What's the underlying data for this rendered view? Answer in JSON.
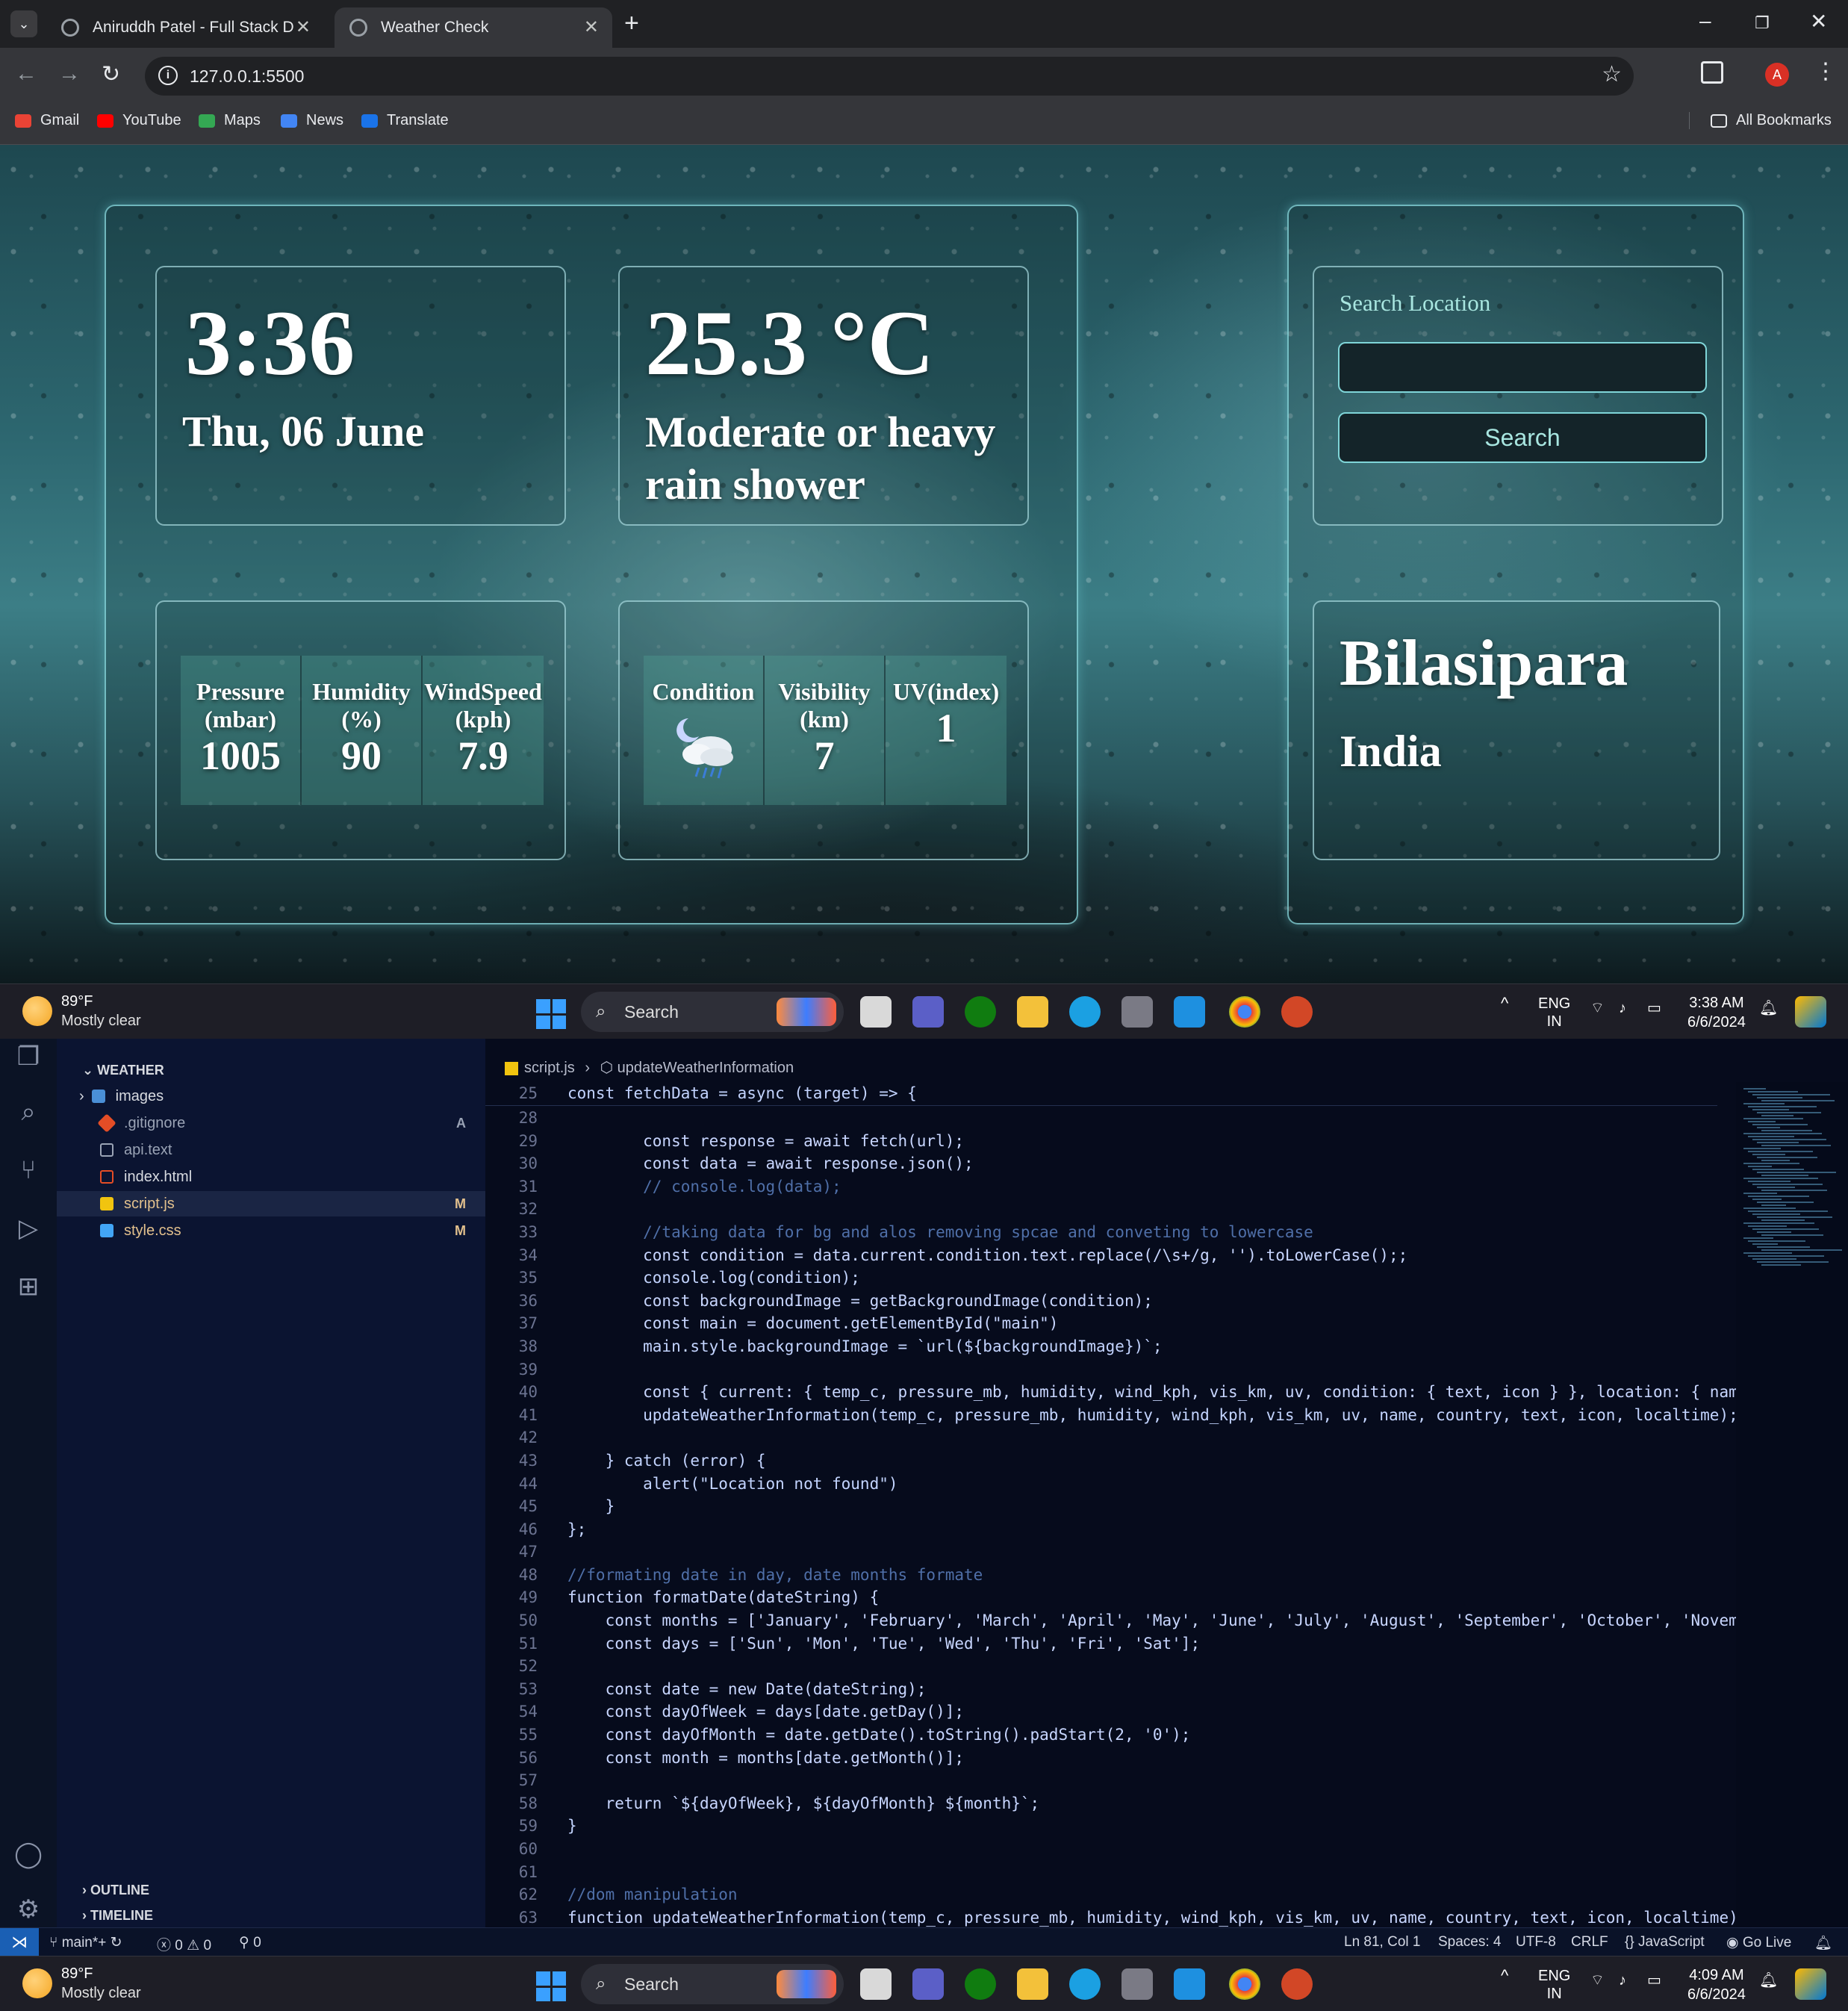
{
  "browser": {
    "tabs": [
      {
        "title": "Aniruddh Patel - Full Stack Developer"
      },
      {
        "title": "Weather Check"
      }
    ],
    "url": "127.0.0.1:5500",
    "bookmarks": [
      "Gmail",
      "YouTube",
      "Maps",
      "News",
      "Translate"
    ],
    "all_bookmarks": "All Bookmarks",
    "profile_initial": "A"
  },
  "weather": {
    "time": "3:36",
    "date": "Thu, 06 June",
    "temperature": "25.3 °C",
    "condition": "Moderate or heavy rain shower",
    "stats1": [
      {
        "label": "Pressure (mbar)",
        "value": "1005"
      },
      {
        "label": "Humidity (%)",
        "value": "90"
      },
      {
        "label": "WindSpeed (kph)",
        "value": "7.9"
      }
    ],
    "stats2": [
      {
        "label": "Condition",
        "icon": "rain-shower-night-icon"
      },
      {
        "label": "Visibility (km)",
        "value": "7"
      },
      {
        "label": "UV(index)",
        "value": "1"
      }
    ],
    "search_title": "Search Location",
    "search_placeholder": "",
    "search_button": "Search",
    "city": "Bilasipara",
    "country": "India"
  },
  "taskbar_top": {
    "weather_temp": "89°F",
    "weather_cond": "Mostly clear",
    "search": "Search",
    "lang1": "ENG",
    "lang2": "IN",
    "time": "3:38 AM",
    "date": "6/6/2024"
  },
  "vscode": {
    "explorer_title": "WEATHER",
    "files": [
      {
        "name": "images",
        "badge": ""
      },
      {
        "name": ".gitignore",
        "badge": "A"
      },
      {
        "name": "api.text",
        "badge": ""
      },
      {
        "name": "index.html",
        "badge": ""
      },
      {
        "name": "script.js",
        "badge": "M"
      },
      {
        "name": "style.css",
        "badge": "M"
      }
    ],
    "outline": "OUTLINE",
    "timeline": "TIMELINE",
    "breadcrumb_file": "script.js",
    "breadcrumb_symbol": "updateWeatherInformation",
    "sticky_line": {
      "n": "25",
      "t": "const fetchData = async (target) => {"
    },
    "code": [
      {
        "n": "28",
        "t": ""
      },
      {
        "n": "29",
        "t": "        const response = await fetch(url);"
      },
      {
        "n": "30",
        "t": "        const data = await response.json();"
      },
      {
        "n": "31",
        "t": "        // console.log(data);"
      },
      {
        "n": "32",
        "t": ""
      },
      {
        "n": "33",
        "t": "        //taking data for bg and alos removing spcae and conveting to lowercase"
      },
      {
        "n": "34",
        "t": "        const condition = data.current.condition.text.replace(/\\s+/g, '').toLowerCase();;"
      },
      {
        "n": "35",
        "t": "        console.log(condition);"
      },
      {
        "n": "36",
        "t": "        const backgroundImage = getBackgroundImage(condition);"
      },
      {
        "n": "37",
        "t": "        const main = document.getElementById(\"main\")"
      },
      {
        "n": "38",
        "t": "        main.style.backgroundImage = `url(${backgroundImage})`;"
      },
      {
        "n": "39",
        "t": ""
      },
      {
        "n": "40",
        "t": "        const { current: { temp_c, pressure_mb, humidity, wind_kph, vis_km, uv, condition: { text, icon } }, location: { nam"
      },
      {
        "n": "41",
        "t": "        updateWeatherInformation(temp_c, pressure_mb, humidity, wind_kph, vis_km, uv, name, country, text, icon, localtime);"
      },
      {
        "n": "42",
        "t": ""
      },
      {
        "n": "43",
        "t": "    } catch (error) {"
      },
      {
        "n": "44",
        "t": "        alert(\"Location not found\")"
      },
      {
        "n": "45",
        "t": "    }"
      },
      {
        "n": "46",
        "t": "};"
      },
      {
        "n": "47",
        "t": ""
      },
      {
        "n": "48",
        "t": "//formating date in day, date months formate"
      },
      {
        "n": "49",
        "t": "function formatDate(dateString) {"
      },
      {
        "n": "50",
        "t": "    const months = ['January', 'February', 'March', 'April', 'May', 'June', 'July', 'August', 'September', 'October', 'Novem"
      },
      {
        "n": "51",
        "t": "    const days = ['Sun', 'Mon', 'Tue', 'Wed', 'Thu', 'Fri', 'Sat'];"
      },
      {
        "n": "52",
        "t": ""
      },
      {
        "n": "53",
        "t": "    const date = new Date(dateString);"
      },
      {
        "n": "54",
        "t": "    const dayOfWeek = days[date.getDay()];"
      },
      {
        "n": "55",
        "t": "    const dayOfMonth = date.getDate().toString().padStart(2, '0');"
      },
      {
        "n": "56",
        "t": "    const month = months[date.getMonth()];"
      },
      {
        "n": "57",
        "t": ""
      },
      {
        "n": "58",
        "t": "    return `${dayOfWeek}, ${dayOfMonth} ${month}`;"
      },
      {
        "n": "59",
        "t": "}"
      },
      {
        "n": "60",
        "t": ""
      },
      {
        "n": "61",
        "t": ""
      },
      {
        "n": "62",
        "t": "//dom manipulation"
      },
      {
        "n": "63",
        "t": "function updateWeatherInformation(temp_c, pressure_mb, humidity, wind_kph, vis_km, uv, name, country, text, icon, localtime)"
      }
    ],
    "status": {
      "branch": "main*+",
      "problems": "0",
      "warnings": "0",
      "ports": "0",
      "position": "Ln 81, Col 1",
      "spaces": "Spaces: 4",
      "encoding": "UTF-8",
      "eol": "CRLF",
      "language": "JavaScript",
      "golive": "Go Live"
    }
  },
  "taskbar_bottom": {
    "weather_temp": "89°F",
    "weather_cond": "Mostly clear",
    "search": "Search",
    "lang1": "ENG",
    "lang2": "IN",
    "time": "4:09 AM",
    "date": "6/6/2024"
  }
}
